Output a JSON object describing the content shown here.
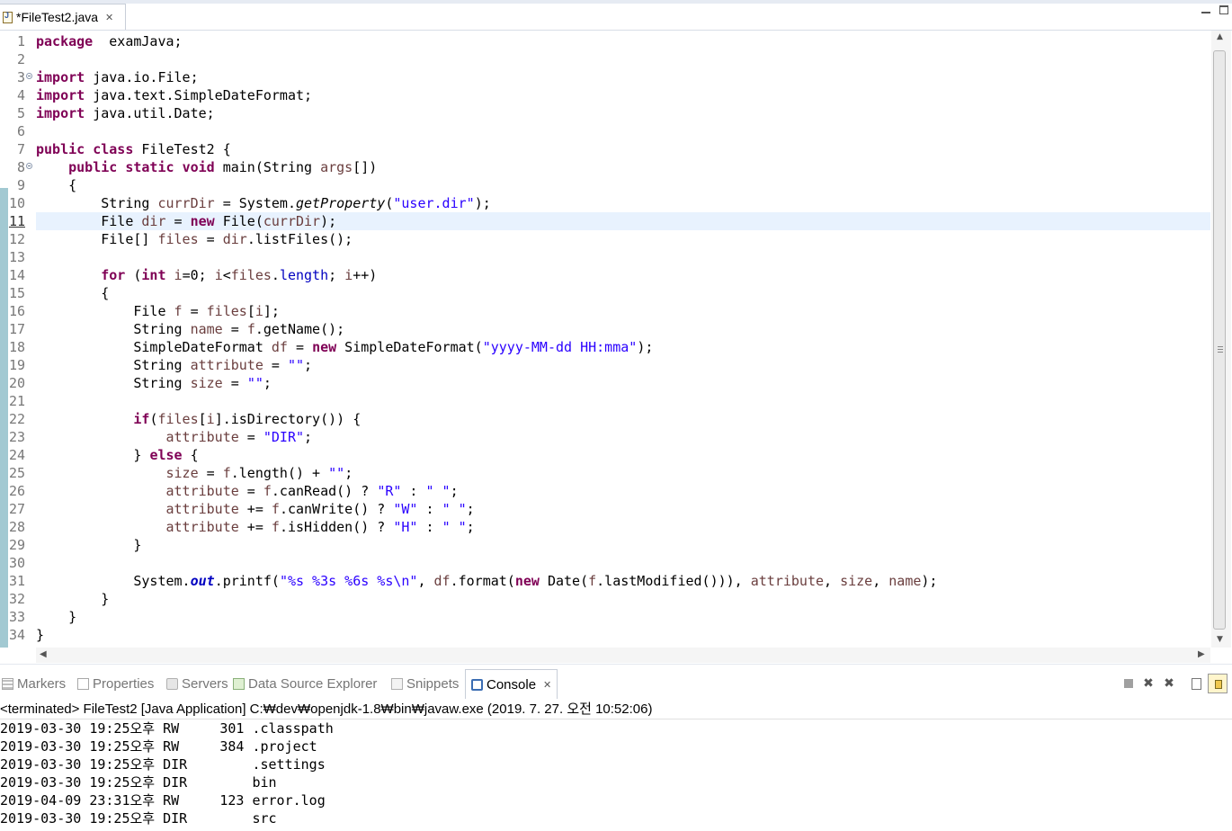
{
  "editor_tab": {
    "title": "*FileTest2.java",
    "close": "✕",
    "icon": "java-file-icon"
  },
  "editor": {
    "current_line": 11,
    "lines": [
      {
        "n": "1",
        "t": [
          [
            "kw",
            "package"
          ],
          [
            "",
            "  examJava;"
          ]
        ]
      },
      {
        "n": "2",
        "t": []
      },
      {
        "n": "3",
        "fold": true,
        "t": [
          [
            "kw",
            "import"
          ],
          [
            "",
            " java.io.File;"
          ]
        ]
      },
      {
        "n": "4",
        "t": [
          [
            "kw",
            "import"
          ],
          [
            "",
            " java.text.SimpleDateFormat;"
          ]
        ]
      },
      {
        "n": "5",
        "t": [
          [
            "kw",
            "import"
          ],
          [
            "",
            " java.util.Date;"
          ]
        ]
      },
      {
        "n": "6",
        "t": []
      },
      {
        "n": "7",
        "t": [
          [
            "kw",
            "public"
          ],
          [
            "",
            " "
          ],
          [
            "kw",
            "class"
          ],
          [
            "",
            " FileTest2 {"
          ]
        ]
      },
      {
        "n": "8",
        "fold": true,
        "t": [
          [
            "",
            "    "
          ],
          [
            "kw",
            "public"
          ],
          [
            "",
            " "
          ],
          [
            "kw",
            "static"
          ],
          [
            "",
            " "
          ],
          [
            "kw",
            "void"
          ],
          [
            "",
            " main(String "
          ],
          [
            "var",
            "args"
          ],
          [
            "",
            "[])"
          ]
        ]
      },
      {
        "n": "9",
        "t": [
          [
            "",
            "    {"
          ]
        ]
      },
      {
        "n": "10",
        "t": [
          [
            "",
            "        String "
          ],
          [
            "var",
            "currDir"
          ],
          [
            "",
            " = System."
          ],
          [
            "smeth",
            "getProperty"
          ],
          [
            "",
            "("
          ],
          [
            "str",
            "\"user.dir\""
          ],
          [
            "",
            ");"
          ]
        ]
      },
      {
        "n": "11",
        "t": [
          [
            "",
            "        File "
          ],
          [
            "var",
            "dir"
          ],
          [
            "",
            " = "
          ],
          [
            "kw",
            "new"
          ],
          [
            "",
            " File("
          ],
          [
            "var",
            "currDir"
          ],
          [
            "",
            ");"
          ]
        ]
      },
      {
        "n": "12",
        "t": [
          [
            "",
            "        File[] "
          ],
          [
            "var",
            "files"
          ],
          [
            "",
            " = "
          ],
          [
            "var",
            "dir"
          ],
          [
            "",
            ".listFiles();"
          ]
        ]
      },
      {
        "n": "13",
        "t": []
      },
      {
        "n": "14",
        "t": [
          [
            "",
            "        "
          ],
          [
            "kw",
            "for"
          ],
          [
            "",
            " ("
          ],
          [
            "kw",
            "int"
          ],
          [
            "",
            " "
          ],
          [
            "var",
            "i"
          ],
          [
            "",
            "=0; "
          ],
          [
            "var",
            "i"
          ],
          [
            "",
            "<"
          ],
          [
            "var",
            "files"
          ],
          [
            "",
            "."
          ],
          [
            "fld",
            "length"
          ],
          [
            "",
            "; "
          ],
          [
            "var",
            "i"
          ],
          [
            "",
            "++)"
          ]
        ]
      },
      {
        "n": "15",
        "t": [
          [
            "",
            "        {"
          ]
        ]
      },
      {
        "n": "16",
        "t": [
          [
            "",
            "            File "
          ],
          [
            "var",
            "f"
          ],
          [
            "",
            " = "
          ],
          [
            "var",
            "files"
          ],
          [
            "",
            "["
          ],
          [
            "var",
            "i"
          ],
          [
            "",
            "];"
          ]
        ]
      },
      {
        "n": "17",
        "t": [
          [
            "",
            "            String "
          ],
          [
            "var",
            "name"
          ],
          [
            "",
            " = "
          ],
          [
            "var",
            "f"
          ],
          [
            "",
            ".getName();"
          ]
        ]
      },
      {
        "n": "18",
        "t": [
          [
            "",
            "            SimpleDateFormat "
          ],
          [
            "var",
            "df"
          ],
          [
            "",
            " = "
          ],
          [
            "kw",
            "new"
          ],
          [
            "",
            " SimpleDateFormat("
          ],
          [
            "str",
            "\"yyyy-MM-dd HH:mma\""
          ],
          [
            "",
            ");"
          ]
        ]
      },
      {
        "n": "19",
        "t": [
          [
            "",
            "            String "
          ],
          [
            "var",
            "attribute"
          ],
          [
            "",
            " = "
          ],
          [
            "str",
            "\"\""
          ],
          [
            "",
            ";"
          ]
        ]
      },
      {
        "n": "20",
        "t": [
          [
            "",
            "            String "
          ],
          [
            "var",
            "size"
          ],
          [
            "",
            " = "
          ],
          [
            "str",
            "\"\""
          ],
          [
            "",
            ";"
          ]
        ]
      },
      {
        "n": "21",
        "t": []
      },
      {
        "n": "22",
        "t": [
          [
            "",
            "            "
          ],
          [
            "kw",
            "if"
          ],
          [
            "",
            "("
          ],
          [
            "var",
            "files"
          ],
          [
            "",
            "["
          ],
          [
            "var",
            "i"
          ],
          [
            "",
            "].isDirectory()) {"
          ]
        ]
      },
      {
        "n": "23",
        "t": [
          [
            "",
            "                "
          ],
          [
            "var",
            "attribute"
          ],
          [
            "",
            " = "
          ],
          [
            "str",
            "\"DIR\""
          ],
          [
            "",
            ";"
          ]
        ]
      },
      {
        "n": "24",
        "t": [
          [
            "",
            "            } "
          ],
          [
            "kw",
            "else"
          ],
          [
            "",
            " {"
          ]
        ]
      },
      {
        "n": "25",
        "t": [
          [
            "",
            "                "
          ],
          [
            "var",
            "size"
          ],
          [
            "",
            " = "
          ],
          [
            "var",
            "f"
          ],
          [
            "",
            ".length() + "
          ],
          [
            "str",
            "\"\""
          ],
          [
            "",
            ";"
          ]
        ]
      },
      {
        "n": "26",
        "t": [
          [
            "",
            "                "
          ],
          [
            "var",
            "attribute"
          ],
          [
            "",
            " = "
          ],
          [
            "var",
            "f"
          ],
          [
            "",
            ".canRead() ? "
          ],
          [
            "str",
            "\"R\""
          ],
          [
            "",
            " : "
          ],
          [
            "str",
            "\" \""
          ],
          [
            "",
            ";"
          ]
        ]
      },
      {
        "n": "27",
        "t": [
          [
            "",
            "                "
          ],
          [
            "var",
            "attribute"
          ],
          [
            "",
            " += "
          ],
          [
            "var",
            "f"
          ],
          [
            "",
            ".canWrite() ? "
          ],
          [
            "str",
            "\"W\""
          ],
          [
            "",
            " : "
          ],
          [
            "str",
            "\" \""
          ],
          [
            "",
            ";"
          ]
        ]
      },
      {
        "n": "28",
        "t": [
          [
            "",
            "                "
          ],
          [
            "var",
            "attribute"
          ],
          [
            "",
            " += "
          ],
          [
            "var",
            "f"
          ],
          [
            "",
            ".isHidden() ? "
          ],
          [
            "str",
            "\"H\""
          ],
          [
            "",
            " : "
          ],
          [
            "str",
            "\" \""
          ],
          [
            "",
            ";"
          ]
        ]
      },
      {
        "n": "29",
        "t": [
          [
            "",
            "            }"
          ]
        ]
      },
      {
        "n": "30",
        "t": []
      },
      {
        "n": "31",
        "t": [
          [
            "",
            "            System."
          ],
          [
            "sfld",
            "out"
          ],
          [
            "",
            ".printf("
          ],
          [
            "str",
            "\"%s %3s %6s %s\\n\""
          ],
          [
            "",
            ", "
          ],
          [
            "var",
            "df"
          ],
          [
            "",
            ".format("
          ],
          [
            "kw",
            "new"
          ],
          [
            "",
            " Date("
          ],
          [
            "var",
            "f"
          ],
          [
            "",
            ".lastModified())), "
          ],
          [
            "var",
            "attribute"
          ],
          [
            "",
            ", "
          ],
          [
            "var",
            "size"
          ],
          [
            "",
            ", "
          ],
          [
            "var",
            "name"
          ],
          [
            "",
            ");"
          ]
        ]
      },
      {
        "n": "32",
        "t": [
          [
            "",
            "        }"
          ]
        ]
      },
      {
        "n": "33",
        "t": [
          [
            "",
            "    }"
          ]
        ]
      },
      {
        "n": "34",
        "t": [
          [
            "",
            "}"
          ]
        ]
      }
    ]
  },
  "views": {
    "tabs": [
      {
        "label": "Markers",
        "icon": "markers-icon"
      },
      {
        "label": "Properties",
        "icon": "properties-icon"
      },
      {
        "label": "Servers",
        "icon": "servers-icon"
      },
      {
        "label": "Data Source Explorer",
        "icon": "data-source-explorer-icon"
      },
      {
        "label": "Snippets",
        "icon": "snippets-icon"
      },
      {
        "label": "Console",
        "icon": "console-icon",
        "active": true
      }
    ],
    "close": "✕",
    "toolbar": {
      "remove_launch": "✖",
      "remove_all": "✖"
    }
  },
  "console": {
    "description": "<terminated> FileTest2 [Java Application] C:₩dev₩openjdk-1.8₩bin₩javaw.exe (2019. 7. 27. 오전 10:52:06)",
    "output": [
      "2019-03-30 19:25오후 RW     301 .classpath",
      "2019-03-30 19:25오후 RW     384 .project",
      "2019-03-30 19:25오후 DIR        .settings",
      "2019-03-30 19:25오후 DIR        bin",
      "2019-04-09 23:31오후 RW     123 error.log",
      "2019-03-30 19:25오후 DIR        src"
    ]
  }
}
